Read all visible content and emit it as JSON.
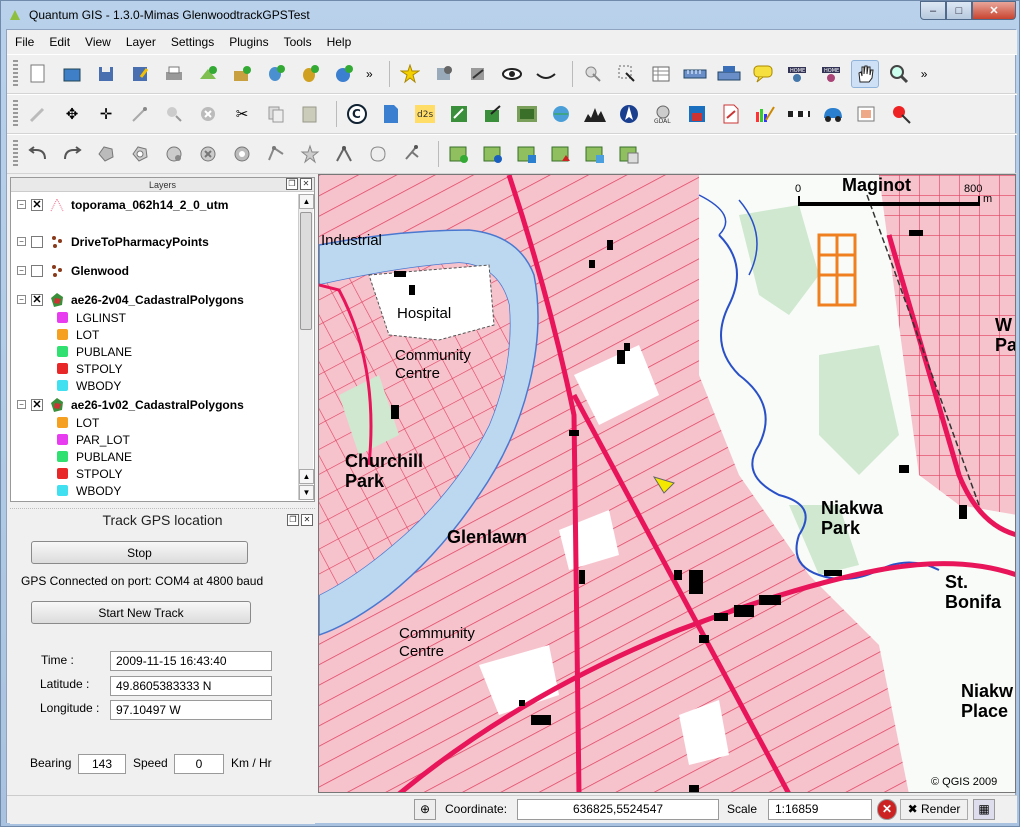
{
  "window": {
    "title": "Quantum GIS - 1.3.0-Mimas GlenwoodtrackGPSTest"
  },
  "menu": [
    "File",
    "Edit",
    "View",
    "Layer",
    "Settings",
    "Plugins",
    "Tools",
    "Help"
  ],
  "toolbar_more": "»",
  "layers_panel": {
    "title": "Layers",
    "items": [
      {
        "name": "toporama_062h14_2_0_utm",
        "checked": true,
        "expanded": true
      },
      {
        "name": "DriveToPharmacyPoints",
        "checked": false,
        "expanded": true
      },
      {
        "name": "Glenwood",
        "checked": false,
        "expanded": true
      },
      {
        "name": "ae26-2v04_CadastralPolygons",
        "checked": true,
        "expanded": true,
        "classes": [
          {
            "label": "LGLINST",
            "color": "#e83cf0"
          },
          {
            "label": "LOT",
            "color": "#f5a020"
          },
          {
            "label": "PUBLANE",
            "color": "#30e070"
          },
          {
            "label": "STPOLY",
            "color": "#e82828"
          },
          {
            "label": "WBODY",
            "color": "#40e0f0"
          }
        ]
      },
      {
        "name": "ae26-1v02_CadastralPolygons",
        "checked": true,
        "expanded": true,
        "classes": [
          {
            "label": "LOT",
            "color": "#f5a020"
          },
          {
            "label": "PAR_LOT",
            "color": "#e83cf0"
          },
          {
            "label": "PUBLANE",
            "color": "#30e070"
          },
          {
            "label": "STPOLY",
            "color": "#e82828"
          },
          {
            "label": "WBODY",
            "color": "#40e0f0"
          }
        ]
      }
    ]
  },
  "gps": {
    "title": "Track GPS location",
    "stop_label": "Stop",
    "status": "GPS Connected on port: COM4 at 4800 baud",
    "new_track_label": "Start New Track",
    "time_label": "Time :",
    "time": "2009-11-15 16:43:40",
    "lat_label": "Latitude :",
    "lat": "49.8605383333 N",
    "lon_label": "Longitude :",
    "lon": "97.10497 W",
    "bearing_label": "Bearing",
    "bearing": "143",
    "speed_label": "Speed",
    "speed": "0",
    "speed_unit": "Km / Hr"
  },
  "map": {
    "scalebar": {
      "start": "0",
      "end": "800",
      "unit": "m"
    },
    "labels": {
      "maginot": "Maginot",
      "industrial": "Industrial",
      "hospital": "Hospital",
      "community_centre_1a": "Community",
      "community_centre_1b": "Centre",
      "churchill_a": "Churchill",
      "churchill_b": "Park",
      "glenlawn": "Glenlawn",
      "niakwa_park_a": "Niakwa",
      "niakwa_park_b": "Park",
      "community_centre_2a": "Community",
      "community_centre_2b": "Centre",
      "st_boniface_a": "St.",
      "st_boniface_b": "Bonifa",
      "niakwa_place_a": "Niakw",
      "niakwa_place_b": "Place",
      "w_a": "W",
      "w_b": "Pa",
      "copyright": "© QGIS 2009"
    }
  },
  "status": {
    "coordinate_label": "Coordinate:",
    "coordinate": "636825,5524547",
    "scale_label": "Scale",
    "scale": "1:16859",
    "render_label": "Render"
  }
}
